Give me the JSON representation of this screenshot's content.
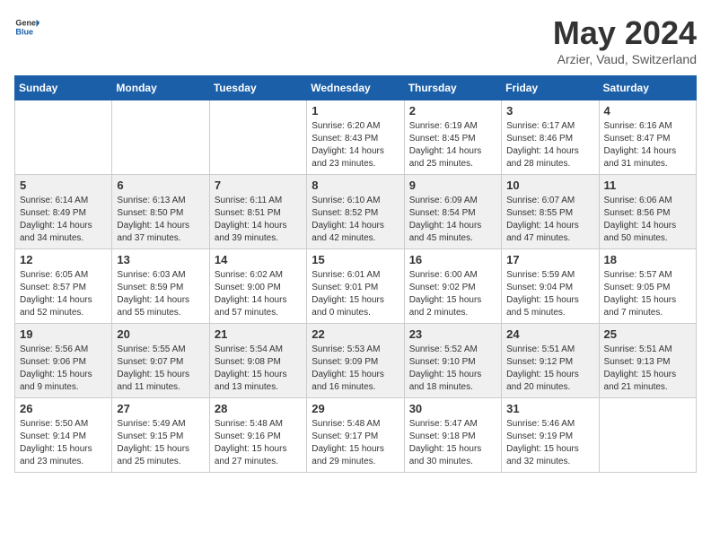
{
  "header": {
    "logo_general": "General",
    "logo_blue": "Blue",
    "month_title": "May 2024",
    "location": "Arzier, Vaud, Switzerland"
  },
  "days_of_week": [
    "Sunday",
    "Monday",
    "Tuesday",
    "Wednesday",
    "Thursday",
    "Friday",
    "Saturday"
  ],
  "weeks": [
    [
      {
        "day": "",
        "info": ""
      },
      {
        "day": "",
        "info": ""
      },
      {
        "day": "",
        "info": ""
      },
      {
        "day": "1",
        "info": "Sunrise: 6:20 AM\nSunset: 8:43 PM\nDaylight: 14 hours\nand 23 minutes."
      },
      {
        "day": "2",
        "info": "Sunrise: 6:19 AM\nSunset: 8:45 PM\nDaylight: 14 hours\nand 25 minutes."
      },
      {
        "day": "3",
        "info": "Sunrise: 6:17 AM\nSunset: 8:46 PM\nDaylight: 14 hours\nand 28 minutes."
      },
      {
        "day": "4",
        "info": "Sunrise: 6:16 AM\nSunset: 8:47 PM\nDaylight: 14 hours\nand 31 minutes."
      }
    ],
    [
      {
        "day": "5",
        "info": "Sunrise: 6:14 AM\nSunset: 8:49 PM\nDaylight: 14 hours\nand 34 minutes."
      },
      {
        "day": "6",
        "info": "Sunrise: 6:13 AM\nSunset: 8:50 PM\nDaylight: 14 hours\nand 37 minutes."
      },
      {
        "day": "7",
        "info": "Sunrise: 6:11 AM\nSunset: 8:51 PM\nDaylight: 14 hours\nand 39 minutes."
      },
      {
        "day": "8",
        "info": "Sunrise: 6:10 AM\nSunset: 8:52 PM\nDaylight: 14 hours\nand 42 minutes."
      },
      {
        "day": "9",
        "info": "Sunrise: 6:09 AM\nSunset: 8:54 PM\nDaylight: 14 hours\nand 45 minutes."
      },
      {
        "day": "10",
        "info": "Sunrise: 6:07 AM\nSunset: 8:55 PM\nDaylight: 14 hours\nand 47 minutes."
      },
      {
        "day": "11",
        "info": "Sunrise: 6:06 AM\nSunset: 8:56 PM\nDaylight: 14 hours\nand 50 minutes."
      }
    ],
    [
      {
        "day": "12",
        "info": "Sunrise: 6:05 AM\nSunset: 8:57 PM\nDaylight: 14 hours\nand 52 minutes."
      },
      {
        "day": "13",
        "info": "Sunrise: 6:03 AM\nSunset: 8:59 PM\nDaylight: 14 hours\nand 55 minutes."
      },
      {
        "day": "14",
        "info": "Sunrise: 6:02 AM\nSunset: 9:00 PM\nDaylight: 14 hours\nand 57 minutes."
      },
      {
        "day": "15",
        "info": "Sunrise: 6:01 AM\nSunset: 9:01 PM\nDaylight: 15 hours\nand 0 minutes."
      },
      {
        "day": "16",
        "info": "Sunrise: 6:00 AM\nSunset: 9:02 PM\nDaylight: 15 hours\nand 2 minutes."
      },
      {
        "day": "17",
        "info": "Sunrise: 5:59 AM\nSunset: 9:04 PM\nDaylight: 15 hours\nand 5 minutes."
      },
      {
        "day": "18",
        "info": "Sunrise: 5:57 AM\nSunset: 9:05 PM\nDaylight: 15 hours\nand 7 minutes."
      }
    ],
    [
      {
        "day": "19",
        "info": "Sunrise: 5:56 AM\nSunset: 9:06 PM\nDaylight: 15 hours\nand 9 minutes."
      },
      {
        "day": "20",
        "info": "Sunrise: 5:55 AM\nSunset: 9:07 PM\nDaylight: 15 hours\nand 11 minutes."
      },
      {
        "day": "21",
        "info": "Sunrise: 5:54 AM\nSunset: 9:08 PM\nDaylight: 15 hours\nand 13 minutes."
      },
      {
        "day": "22",
        "info": "Sunrise: 5:53 AM\nSunset: 9:09 PM\nDaylight: 15 hours\nand 16 minutes."
      },
      {
        "day": "23",
        "info": "Sunrise: 5:52 AM\nSunset: 9:10 PM\nDaylight: 15 hours\nand 18 minutes."
      },
      {
        "day": "24",
        "info": "Sunrise: 5:51 AM\nSunset: 9:12 PM\nDaylight: 15 hours\nand 20 minutes."
      },
      {
        "day": "25",
        "info": "Sunrise: 5:51 AM\nSunset: 9:13 PM\nDaylight: 15 hours\nand 21 minutes."
      }
    ],
    [
      {
        "day": "26",
        "info": "Sunrise: 5:50 AM\nSunset: 9:14 PM\nDaylight: 15 hours\nand 23 minutes."
      },
      {
        "day": "27",
        "info": "Sunrise: 5:49 AM\nSunset: 9:15 PM\nDaylight: 15 hours\nand 25 minutes."
      },
      {
        "day": "28",
        "info": "Sunrise: 5:48 AM\nSunset: 9:16 PM\nDaylight: 15 hours\nand 27 minutes."
      },
      {
        "day": "29",
        "info": "Sunrise: 5:48 AM\nSunset: 9:17 PM\nDaylight: 15 hours\nand 29 minutes."
      },
      {
        "day": "30",
        "info": "Sunrise: 5:47 AM\nSunset: 9:18 PM\nDaylight: 15 hours\nand 30 minutes."
      },
      {
        "day": "31",
        "info": "Sunrise: 5:46 AM\nSunset: 9:19 PM\nDaylight: 15 hours\nand 32 minutes."
      },
      {
        "day": "",
        "info": ""
      }
    ]
  ]
}
